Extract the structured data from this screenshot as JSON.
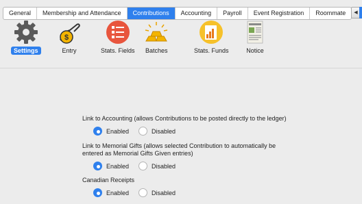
{
  "tabs": [
    {
      "label": "General"
    },
    {
      "label": "Membership and Attendance"
    },
    {
      "label": "Contributions"
    },
    {
      "label": "Accounting"
    },
    {
      "label": "Payroll"
    },
    {
      "label": "Event Registration"
    },
    {
      "label": "Roommate"
    }
  ],
  "active_tab": "Contributions",
  "toolbar": {
    "items": [
      {
        "label": "Settings",
        "icon": "gear-icon"
      },
      {
        "label": "Entry",
        "icon": "money-hand-icon"
      },
      {
        "label": "Stats. Fields",
        "icon": "list-icon"
      },
      {
        "label": "Batches",
        "icon": "gold-bars-icon"
      },
      {
        "label": "Stats. Funds",
        "icon": "bar-chart-icon"
      },
      {
        "label": "Notice",
        "icon": "newspaper-icon"
      }
    ],
    "active": "Settings"
  },
  "settings": [
    {
      "description": "Link to Accounting (allows Contributions to be posted directly to the ledger)",
      "options": [
        "Enabled",
        "Disabled"
      ],
      "selected": "Enabled"
    },
    {
      "description": "Link to Memorial Gifts (allows selected Contribution to automatically be entered as Memorial Gifts Given entries)",
      "options": [
        "Enabled",
        "Disabled"
      ],
      "selected": "Enabled"
    },
    {
      "description": "Canadian Receipts",
      "options": [
        "Enabled",
        "Disabled"
      ],
      "selected": "Enabled"
    }
  ],
  "colors": {
    "accent": "#2f80ed",
    "background": "#ececec"
  }
}
